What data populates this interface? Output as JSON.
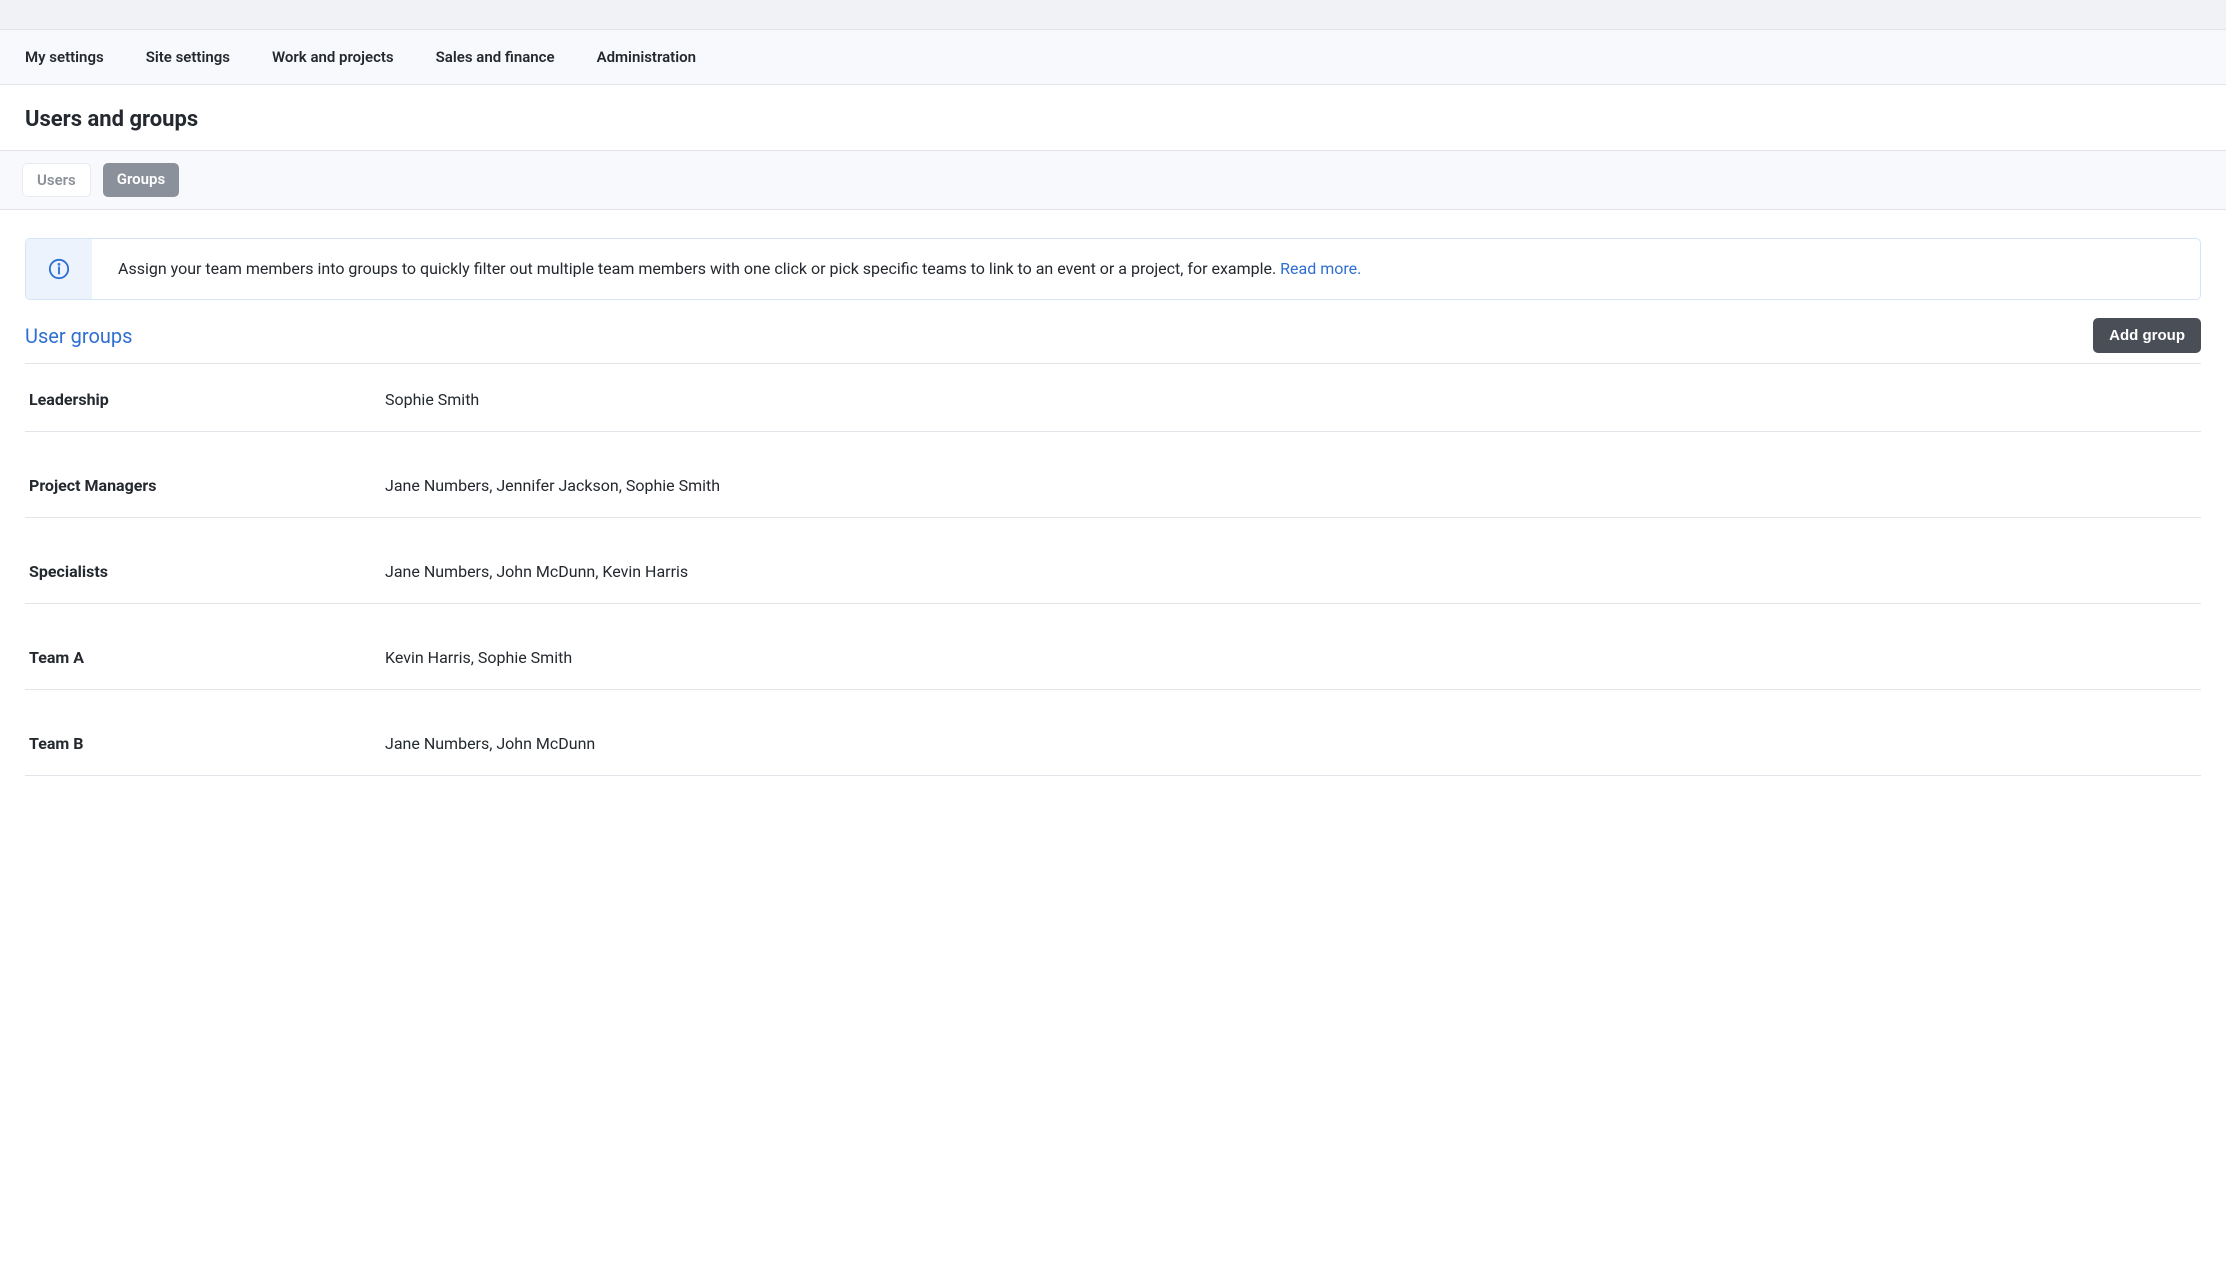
{
  "nav": {
    "items": [
      {
        "label": "My settings"
      },
      {
        "label": "Site settings"
      },
      {
        "label": "Work and projects"
      },
      {
        "label": "Sales and finance"
      },
      {
        "label": "Administration"
      }
    ]
  },
  "page": {
    "title": "Users and groups"
  },
  "tabs": {
    "users": "Users",
    "groups": "Groups"
  },
  "info": {
    "text": "Assign your team members into groups to quickly filter out multiple team members with one click or pick specific teams to link to an event or a project, for example. ",
    "link": "Read more."
  },
  "section": {
    "title": "User groups",
    "add_button": "Add group"
  },
  "groups": [
    {
      "name": "Leadership",
      "members": "Sophie Smith"
    },
    {
      "name": "Project Managers",
      "members": "Jane Numbers, Jennifer Jackson, Sophie Smith"
    },
    {
      "name": "Specialists",
      "members": "Jane Numbers, John McDunn, Kevin Harris"
    },
    {
      "name": "Team A",
      "members": "Kevin Harris, Sophie Smith"
    },
    {
      "name": "Team B",
      "members": "Jane Numbers, John McDunn"
    }
  ]
}
